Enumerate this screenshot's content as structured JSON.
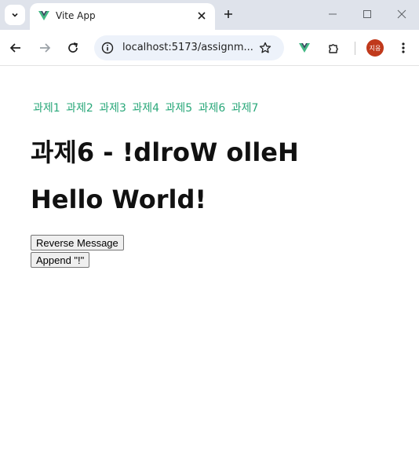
{
  "browser": {
    "tab_title": "Vite App",
    "url": "localhost:5173/assignm...",
    "profile_initials": "지응",
    "colors": {
      "vue_green": "#42b883",
      "vue_dark": "#35495e",
      "avatar": "#c0391b",
      "link": "#2aa87a"
    },
    "icons": [
      "tab-search-icon",
      "vue-logo-icon",
      "close-icon",
      "plus-icon",
      "minimize-icon",
      "maximize-icon",
      "window-close-icon",
      "back-arrow-icon",
      "forward-arrow-icon",
      "reload-icon",
      "site-info-icon",
      "star-icon",
      "vue-devtools-icon",
      "extensions-icon",
      "menu-kebab-icon"
    ]
  },
  "page": {
    "nav": [
      "과제1",
      "과제2",
      "과제3",
      "과제4",
      "과제5",
      "과제6",
      "과제7"
    ],
    "heading_reversed": "과제6 - !dlroW olleH",
    "heading_message": "Hello World!",
    "buttons": {
      "reverse": "Reverse Message",
      "append": "Append \"!\""
    }
  }
}
